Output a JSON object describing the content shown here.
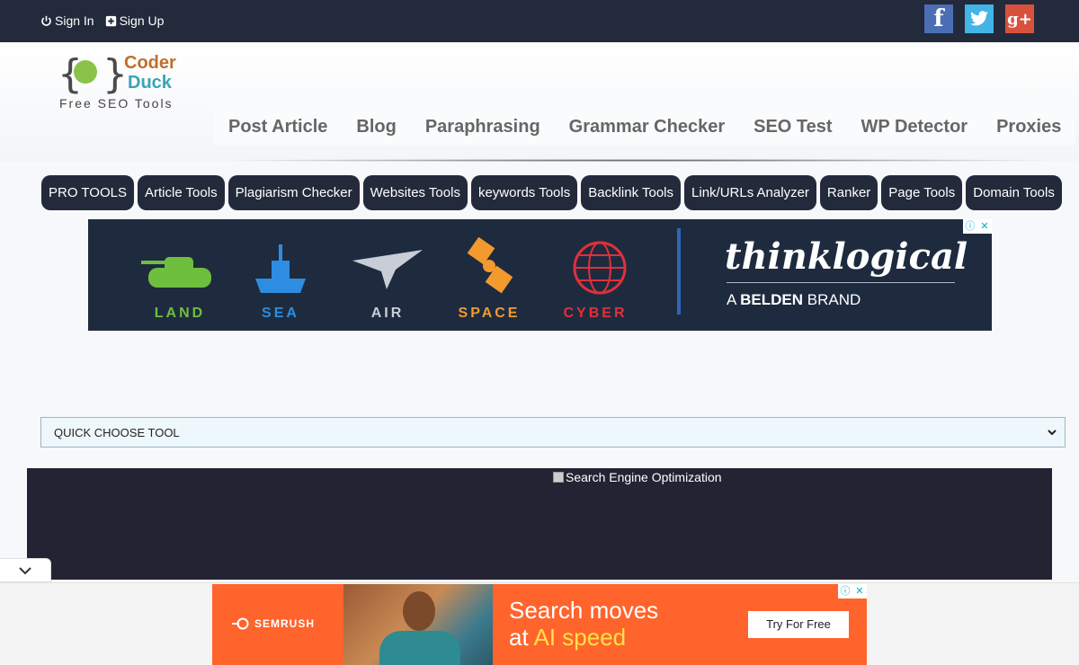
{
  "auth": {
    "sign_in": "Sign In",
    "sign_up": "Sign Up"
  },
  "social": {
    "facebook": "f",
    "google_plus": "g+"
  },
  "logo": {
    "line1": "Coder",
    "line2": "Duck",
    "tagline": "Free SEO Tools"
  },
  "main_nav": [
    "Post Article",
    "Blog",
    "Paraphrasing",
    "Grammar Checker",
    "SEO Test",
    "WP Detector",
    "Proxies"
  ],
  "tool_categories": [
    "PRO TOOLS",
    "Article Tools",
    "Plagiarism Checker",
    "Websites Tools",
    "keywords Tools",
    "Backlink Tools",
    "Link/URLs Analyzer",
    "Ranker",
    "Page Tools",
    "Domain Tools"
  ],
  "ad_top": {
    "items": [
      {
        "label": "LAND",
        "color": "#6fbf3f"
      },
      {
        "label": "SEA",
        "color": "#2e8de0"
      },
      {
        "label": "AIR",
        "color": "#c8cdd6"
      },
      {
        "label": "SPACE",
        "color": "#f29a2e"
      },
      {
        "label": "CYBER",
        "color": "#e0303a"
      }
    ],
    "brand": "thinklogical",
    "sub_prefix": "A ",
    "sub_bold": "BELDEN",
    "sub_suffix": " BRAND"
  },
  "ad_controls": {
    "info": "ⓘ",
    "close": "✕"
  },
  "quick_choose": {
    "selected": "QUICK CHOOSE TOOL"
  },
  "hero": {
    "broken_image_alt": "Search Engine Optimization"
  },
  "ad_bottom": {
    "brand": "SEMRUSH",
    "headline_line1": "Search moves",
    "headline_prefix": "at ",
    "headline_highlight": "AI speed",
    "cta": "Try For Free"
  },
  "colors": {
    "dark_bg": "#232a3b",
    "accent_orange": "#ff642d",
    "highlight_yellow": "#ffe04a"
  }
}
